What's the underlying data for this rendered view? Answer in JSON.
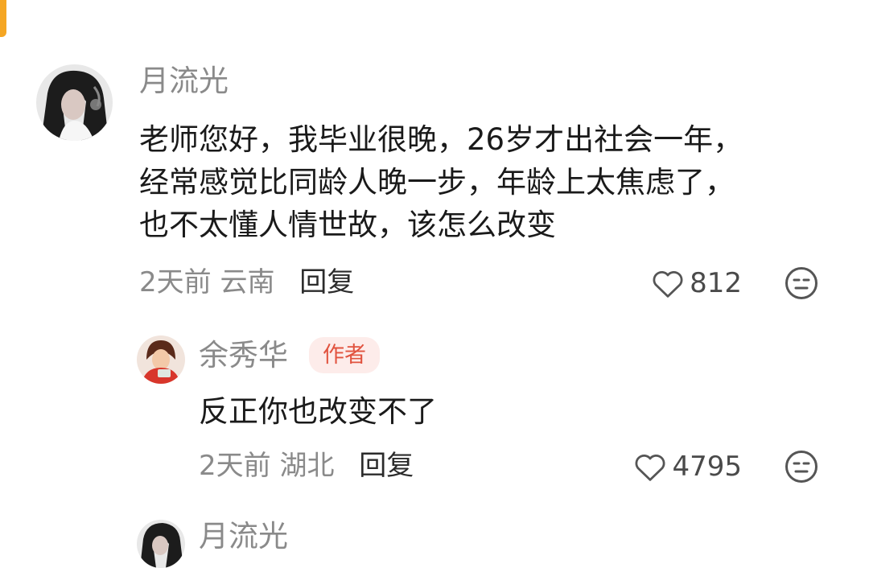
{
  "comments": [
    {
      "author": "月流光",
      "lines": [
        "老师您好，我毕业很晚，26岁才出社会一年，",
        "经常感觉比同龄人晚一步，年龄上太焦虑了，",
        "也不太懂人情世故，该怎么改变"
      ],
      "time": "2天前",
      "location": "云南",
      "reply_label": "回复",
      "likes": "812"
    },
    {
      "author": "余秀华",
      "badge": "作者",
      "lines": [
        "反正你也改变不了"
      ],
      "time": "2天前",
      "location": "湖北",
      "reply_label": "回复",
      "likes": "4795"
    },
    {
      "author": "月流光"
    }
  ],
  "icons": {
    "like": "heart-outline-icon",
    "reaction": "neutral-face-icon"
  },
  "colors": {
    "accent": "#f5a623",
    "author_text": "#8a8a8a",
    "badge_bg": "#fdecea",
    "badge_text": "#e1533f"
  }
}
